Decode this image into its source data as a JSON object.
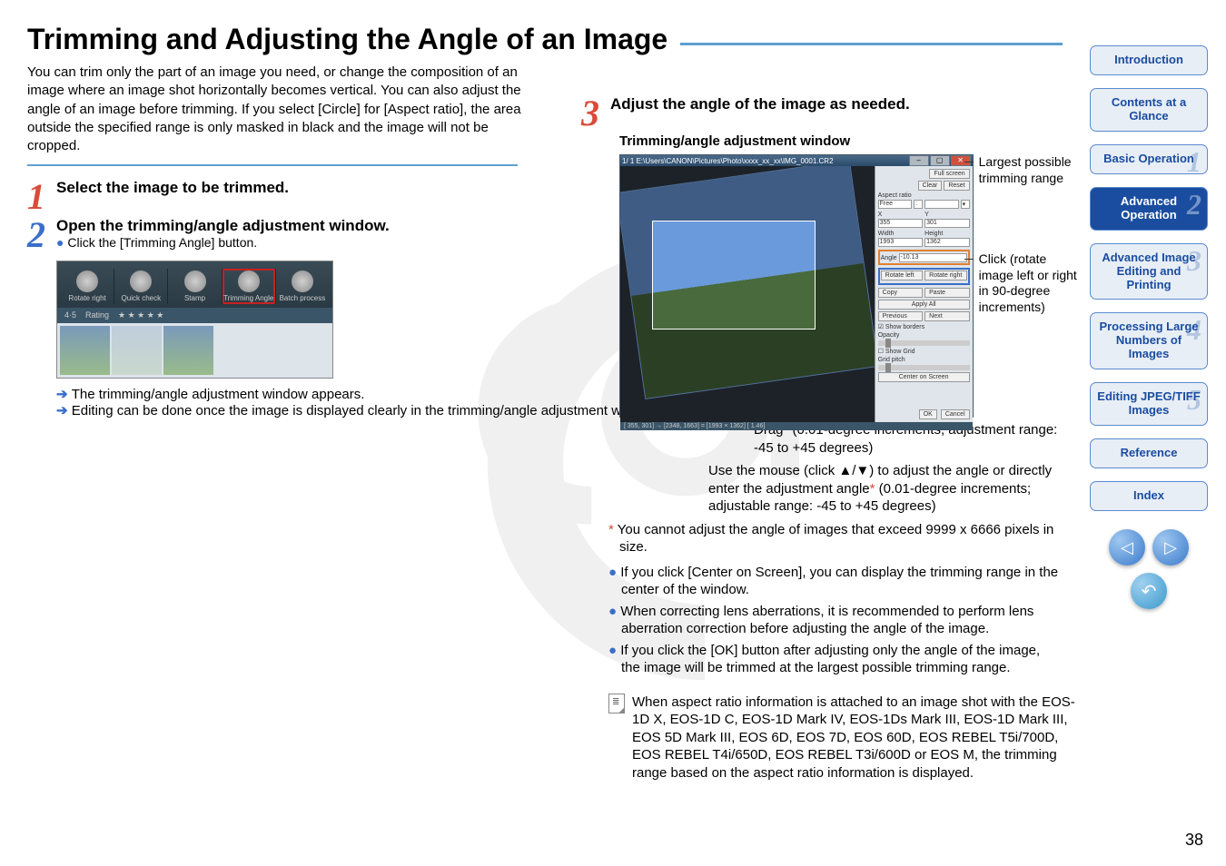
{
  "page": {
    "title": "Trimming and Adjusting the Angle of an Image",
    "number": "38"
  },
  "intro": "You can trim only the part of an image you need, or change the composition of an image where an image shot horizontally becomes vertical. You can also adjust the angle of an image before trimming. If you select [Circle] for [Aspect ratio], the area outside the specified range is only masked in black and the image will not be cropped.",
  "step1": {
    "num": "1",
    "heading": "Select the image to be trimmed."
  },
  "step2": {
    "num": "2",
    "heading": "Open the trimming/angle adjustment window.",
    "sub": "Click the [Trimming Angle] button.",
    "result1": "The trimming/angle adjustment window appears.",
    "result2": "Editing can be done once the image is displayed clearly in the trimming/angle adjustment window."
  },
  "toolbar": {
    "rotate_right": "Rotate right",
    "quick_check": "Quick check",
    "stamp": "Stamp",
    "trimming": "Trimming Angle",
    "batch": "Batch process",
    "label_45": "4·5",
    "rating_lbl": "Rating"
  },
  "step3": {
    "num": "3",
    "heading": "Adjust the angle of the image as needed.",
    "subhead": "Trimming/angle adjustment window"
  },
  "trim_panel": {
    "titlebar": "1/ 1 E:\\Users\\CANON\\Pictures\\Photo\\xxxx_xx_xx\\IMG_0001.CR2",
    "full_screen": "Full screen",
    "clear": "Clear",
    "reset": "Reset",
    "aspect_lbl": "Aspect ratio",
    "aspect_val": "Free",
    "x_lbl": "X",
    "y_lbl": "Y",
    "x_val": "355",
    "y_val": "301",
    "w_lbl": "Width",
    "h_lbl": "Height",
    "w_val": "1993",
    "h_val": "1362",
    "angle_lbl": "Angle",
    "angle_val": "-10.13",
    "rotate_left": "Rotate left",
    "rotate_right": "Rotate right",
    "copy": "Copy",
    "paste": "Paste",
    "apply_all": "Apply All",
    "previous": "Previous",
    "next": "Next",
    "show_borders": "Show borders",
    "opacity": "Opacity",
    "show_grid": "Show Grid",
    "grid_pitch": "Grid pitch",
    "center": "Center on Screen",
    "ok": "OK",
    "cancel": "Cancel",
    "statusbar": "[ 355,  301] → [2348, 1663] = [1993 × 1362] [ 1.46]"
  },
  "callout1": "Largest possible trimming range",
  "callout2": "Click (rotate image left or right in 90-degree increments)",
  "under1_a": "Drag",
  "under1_b": " (0.01-degree increments; adjustment range: -45 to +45 degrees)",
  "under2_a": "Use the mouse (click ▲/▼) to adjust the angle or directly enter the adjustment angle",
  "under2_b": " (0.01-degree increments; adjustable range: -45 to +45 degrees)",
  "ast_note_a": " You cannot adjust the angle of images that exceed 9999 x 6666 pixels in size.",
  "bul1": "If you click [Center on Screen], you can display the trimming range in the center of the window.",
  "bul2": "When correcting lens aberrations, it is recommended to perform lens aberration correction before adjusting the angle of the image.",
  "bul3": "If you click the [OK] button after adjusting only the angle of the image, the image will be trimmed at the largest possible trimming range.",
  "note_box": "When aspect ratio information is attached to an image shot with the EOS-1D X, EOS-1D C, EOS-1D Mark IV, EOS-1Ds Mark III, EOS-1D Mark III, EOS 5D Mark III, EOS 6D, EOS 7D, EOS 60D, EOS REBEL T5i/700D, EOS REBEL T4i/650D, EOS REBEL T3i/600D or EOS M, the trimming range based on the aspect ratio information is displayed.",
  "sidebar": {
    "intro": "Introduction",
    "contents": "Contents at a Glance",
    "basic": "Basic Operation",
    "adv_op": "Advanced Operation",
    "adv_img": "Advanced Image Editing and Printing",
    "proc": "Processing Large Numbers of Images",
    "jpeg": "Editing JPEG/TIFF Images",
    "ref": "Reference",
    "index": "Index",
    "num1": "1",
    "num2": "2",
    "num3": "3",
    "num4": "4",
    "num5": "5"
  }
}
